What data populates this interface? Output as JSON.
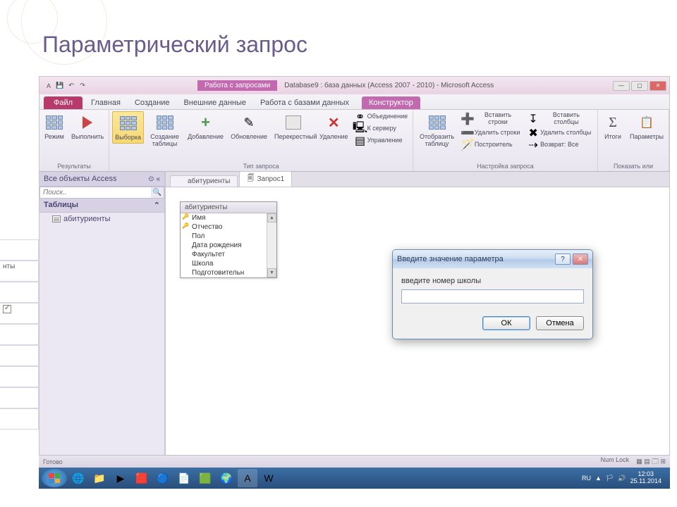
{
  "slide": {
    "title": "Параметрический запрос"
  },
  "window": {
    "context_tab": "Работа с запросами",
    "doc_title": "Database9 : база данных (Access 2007 - 2010) - Microsoft Access"
  },
  "tabs": {
    "file": "Файл",
    "home": "Главная",
    "create": "Создание",
    "external": "Внешние данные",
    "dbtools": "Работа с базами данных",
    "design": "Конструктор"
  },
  "ribbon": {
    "results": {
      "label": "Результаты",
      "view": "Режим",
      "run": "Выполнить"
    },
    "querytype": {
      "label": "Тип запроса",
      "select": "Выборка",
      "maketable": "Создание таблицы",
      "append": "Добавление",
      "update": "Обновление",
      "crosstab": "Перекрестный",
      "delete": "Удаление",
      "union": "Объединение",
      "passthrough": "К серверу",
      "datadef": "Управление"
    },
    "setup": {
      "label": "Настройка запроса",
      "showtable": "Отобразить таблицу",
      "insertrows": "Вставить строки",
      "deleterows": "Удалить строки",
      "builder": "Построитель",
      "insertcols": "Вставить столбцы",
      "deletecols": "Удалить столбцы",
      "return": "Возврат:",
      "return_val": "Все"
    },
    "showhide": {
      "label": "Показать или",
      "totals": "Итоги",
      "params": "Параметры"
    }
  },
  "nav": {
    "header": "Все объекты Access",
    "search_ph": "Поиск..",
    "group_tables": "Таблицы",
    "item1": "абитуриенты"
  },
  "doctabs": {
    "t1": "абитуриенты",
    "t2": "Запрос1"
  },
  "tablebox": {
    "title": "абитуриенты",
    "f1": "Имя",
    "f2": "Отчество",
    "f3": "Пол",
    "f4": "Дата рождения",
    "f5": "Факультет",
    "f6": "Школа",
    "f7": "Подготовительн"
  },
  "dialog": {
    "title": "Введите значение параметра",
    "prompt": "введите номер школы",
    "ok": "ОК",
    "cancel": "Отмена"
  },
  "sidecol": {
    "label": "нты"
  },
  "status": {
    "left": "Готово",
    "numlock": "Num Lock"
  },
  "tray": {
    "lang": "RU",
    "time": "12:03",
    "date": "25.11.2014"
  }
}
